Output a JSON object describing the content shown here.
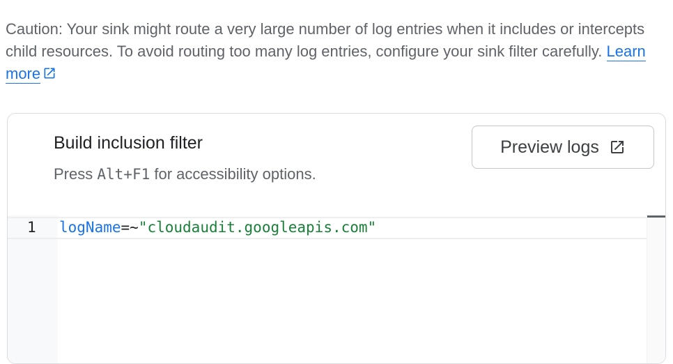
{
  "caution": {
    "text": "Caution: Your sink might route a very large number of log entries when it includes or intercepts child resources. To avoid routing too many log entries, configure your sink filter carefully.",
    "link_label": "Learn more",
    "link_icon": "external-link-icon"
  },
  "filter_card": {
    "title": "Build inclusion filter",
    "subtitle_prefix": "Press",
    "subtitle_key": "Alt+F1",
    "subtitle_suffix": "for accessibility options.",
    "preview_button_label": "Preview logs",
    "preview_button_icon": "external-link-icon"
  },
  "editor": {
    "lines": [
      {
        "number": "1",
        "field": "logName",
        "operator": "=~",
        "value": "\"cloudaudit.googleapis.com\""
      }
    ]
  },
  "colors": {
    "link": "#1a73e8",
    "field_token": "#1a73e8",
    "string_token": "#188038",
    "text_secondary": "#5f6368",
    "text_primary": "#202124",
    "border": "#dadce0"
  }
}
